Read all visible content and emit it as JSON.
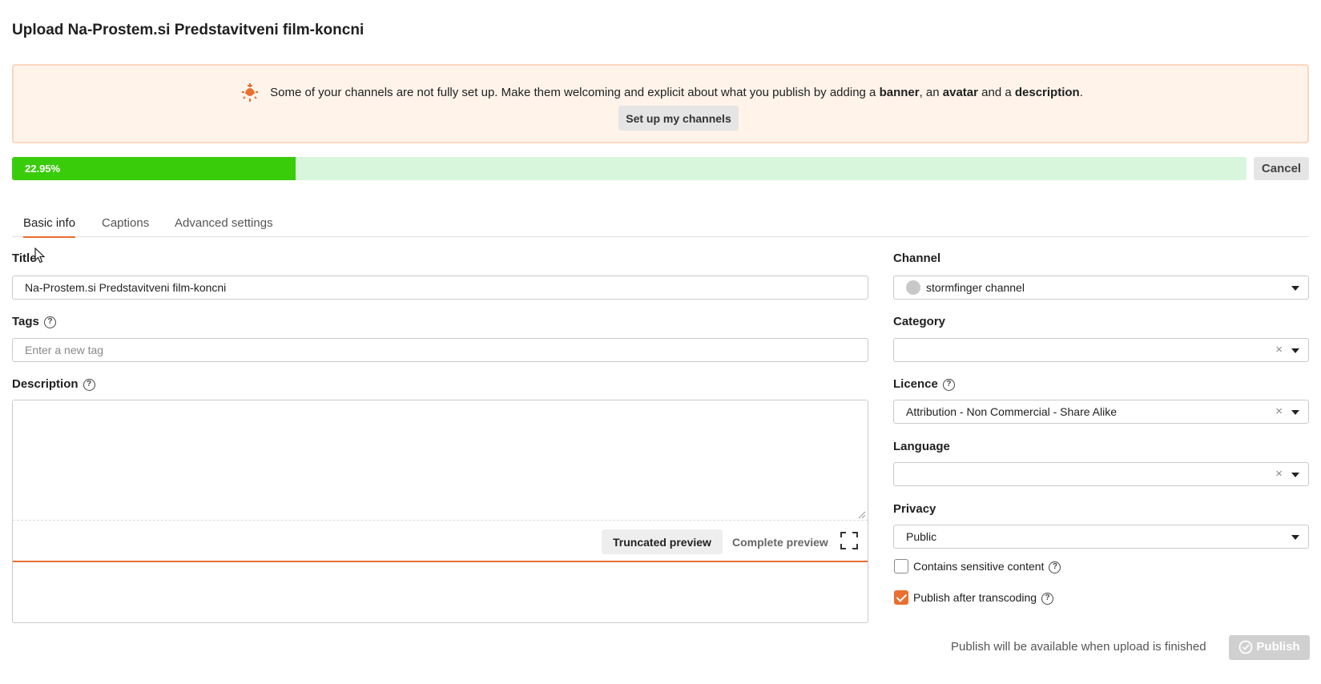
{
  "page": {
    "title": "Upload Na-Prostem.si Predstavitveni film-koncni"
  },
  "alert": {
    "text_prefix": "Some of your channels are not fully set up. Make them welcoming and explicit about what you publish by adding a ",
    "bold_banner": "banner",
    "sep1": ", an ",
    "bold_avatar": "avatar",
    "sep2": " and a ",
    "bold_description": "description",
    "suffix": ".",
    "button_label": "Set up my channels",
    "icon": "lamp-icon"
  },
  "upload": {
    "progress_label": "22.95%",
    "progress_value": 22.95,
    "cancel_label": "Cancel",
    "fill_color": "#39cc0b",
    "track_color": "#d8f6db"
  },
  "tabs": [
    {
      "label": "Basic info",
      "active": true
    },
    {
      "label": "Captions",
      "active": false
    },
    {
      "label": "Advanced settings",
      "active": false
    }
  ],
  "form": {
    "title_label": "Title",
    "title_value": "Na-Prostem.si Predstavitveni film-koncni",
    "tags_label": "Tags",
    "tags_placeholder": "Enter a new tag",
    "description_label": "Description",
    "truncated_preview": "Truncated preview",
    "complete_preview": "Complete preview"
  },
  "sidebar": {
    "channel_label": "Channel",
    "channel_value": "stormfinger channel",
    "category_label": "Category",
    "category_value": "",
    "licence_label": "Licence",
    "licence_value": "Attribution - Non Commercial - Share Alike",
    "language_label": "Language",
    "language_value": "",
    "privacy_label": "Privacy",
    "privacy_value": "Public",
    "sensitive_label": "Contains sensitive content",
    "sensitive_checked": false,
    "publish_after_label": "Publish after transcoding",
    "publish_after_checked": true,
    "clear_glyph": "×"
  },
  "footer": {
    "note": "Publish will be available when upload is finished",
    "publish_label": "Publish"
  },
  "colors": {
    "accent": "#e96f31",
    "alert_bg": "#fff3ea",
    "alert_border": "#fbd6bf"
  }
}
